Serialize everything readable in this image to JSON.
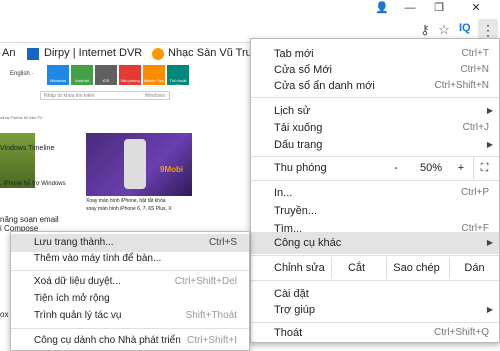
{
  "window": {
    "controls": {
      "account": "👤",
      "minimize": "—",
      "maximize": "❐",
      "close": "✕"
    }
  },
  "toolbar": {
    "key_icon": "⚷",
    "star_icon": "☆",
    "extension_label": "IQ",
    "menu_icon": "⋮"
  },
  "bookmarks": [
    {
      "label": "An"
    },
    {
      "label": "Dirpy | Internet DVR"
    },
    {
      "label": "Nhạc Sàn Vũ Trường"
    }
  ],
  "page": {
    "lang_label": "English ·",
    "tiles": [
      {
        "label": "Windows",
        "color": "#1e88e5"
      },
      {
        "label": "Android",
        "color": "#43a047"
      },
      {
        "label": "iOS",
        "color": "#616161"
      },
      {
        "label": "Văn phòng",
        "color": "#e53935"
      },
      {
        "label": "Mobile Tips",
        "color": "#fb8c00"
      },
      {
        "label": "Thủ thuật PC",
        "color": "#00897b"
      }
    ],
    "search_placeholder": "Nhập từ khóa tìm kiếm",
    "search_select": "Windows",
    "header_line": "cả lại Firefox 60 trên PC",
    "left_lines": [
      "Vindows Timeline",
      "",
      ", iPhone hỗ trợ Windows"
    ],
    "brand_badge": "9Mobi",
    "mid_lines": [
      "Xoay màn hình iPhone, bật tắt khóa",
      "xoay màn hình iPhone 6, 7, 6S Plus, X"
    ],
    "big_left_lines": [
      "năng soạn email",
      "i Compose",
      "ox"
    ]
  },
  "menu": {
    "items": [
      {
        "label": "Tab mới",
        "shortcut": "Ctrl+T"
      },
      {
        "label": "Cửa sổ Mới",
        "shortcut": "Ctrl+N"
      },
      {
        "label": "Cửa sổ ẩn danh mới",
        "shortcut": "Ctrl+Shift+N"
      },
      {
        "label": "Lịch sử",
        "shortcut": "▶"
      },
      {
        "label": "Tải xuống",
        "shortcut": "Ctrl+J"
      },
      {
        "label": "Dấu trang",
        "shortcut": "▶"
      },
      {
        "label": "Thu phóng"
      },
      {
        "label": "In...",
        "shortcut": "Ctrl+P"
      },
      {
        "label": "Truyền..."
      },
      {
        "label": "Tìm...",
        "shortcut": "Ctrl+F"
      },
      {
        "label": "Công cụ khác",
        "shortcut": "▶"
      },
      {
        "label": "Chỉnh sửa"
      },
      {
        "label": "Cài đặt"
      },
      {
        "label": "Trợ giúp",
        "shortcut": "▶"
      },
      {
        "label": "Thoát",
        "shortcut": "Ctrl+Shift+Q"
      }
    ],
    "zoom": {
      "minus": "-",
      "value": "50%",
      "plus": "+",
      "fullscreen": "⛶"
    },
    "edit": {
      "cut": "Cắt",
      "copy": "Sao chép",
      "paste": "Dán"
    }
  },
  "submenu": {
    "items": [
      {
        "label": "Lưu trang thành...",
        "shortcut": "Ctrl+S"
      },
      {
        "label": "Thêm vào máy tính để bàn...",
        "shortcut": ""
      },
      {
        "label": "Xoá dữ liệu duyệt...",
        "shortcut": "Ctrl+Shift+Del"
      },
      {
        "label": "Tiện ích mở rộng",
        "shortcut": ""
      },
      {
        "label": "Trình quản lý tác vụ",
        "shortcut": "Shift+Thoát"
      },
      {
        "label": "Công cụ dành cho Nhà phát triển",
        "shortcut": "Ctrl+Shift+I"
      }
    ]
  }
}
